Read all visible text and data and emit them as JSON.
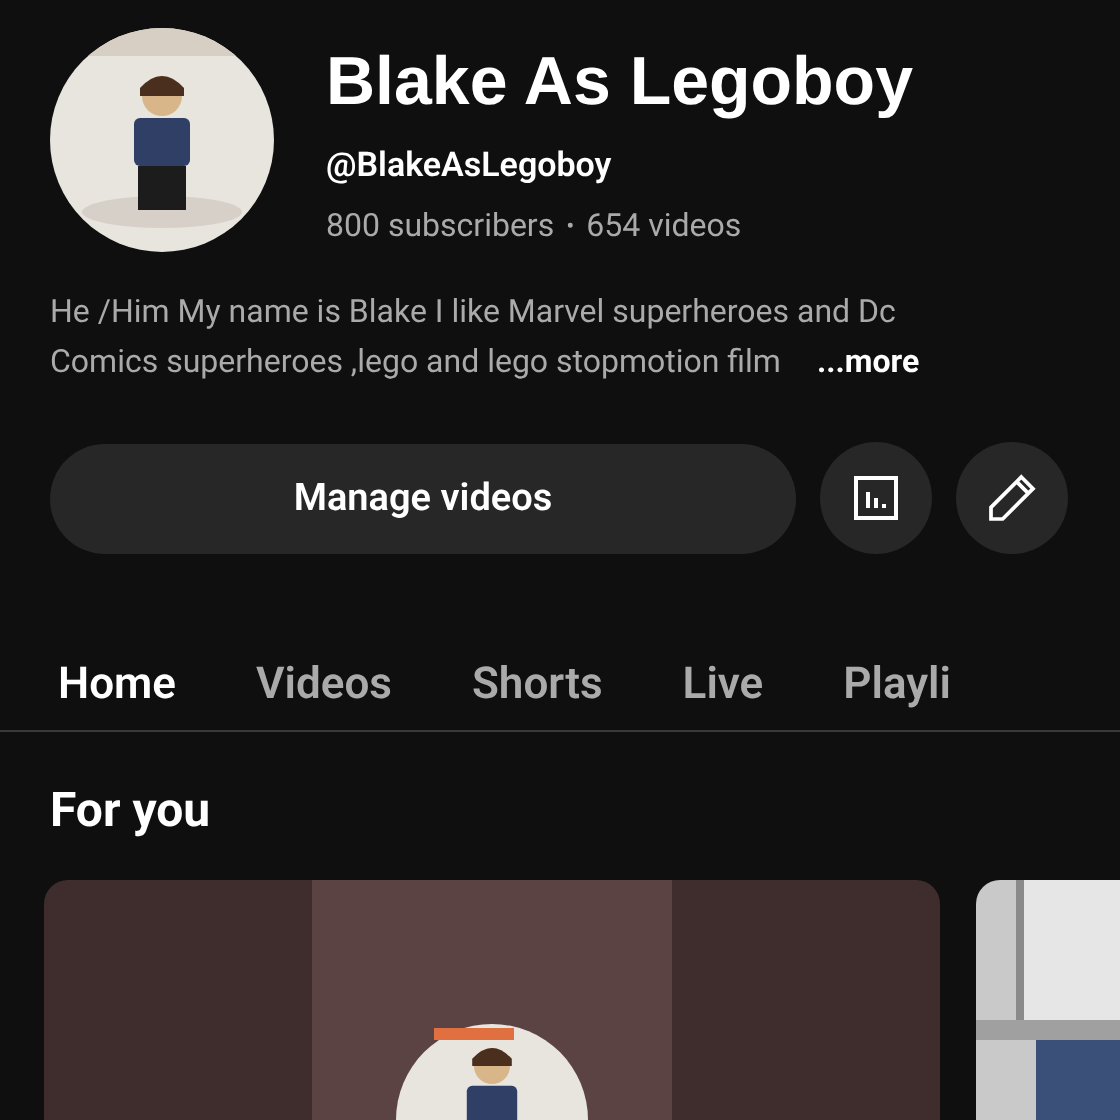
{
  "channel": {
    "name": "Blake As Legoboy",
    "handle": "@BlakeAsLegoboy",
    "subscribers": "800 subscribers",
    "separator": "•",
    "videos": "654 videos",
    "description": [
      "He /Him My name is Blake I like Marvel superheroes and Dc",
      "Comics superheroes ,lego and lego stopmotion film"
    ],
    "more": "...more"
  },
  "actions": {
    "manage": "Manage videos"
  },
  "tabs": [
    {
      "label": "Home",
      "selected": true
    },
    {
      "label": "Videos",
      "selected": false
    },
    {
      "label": "Shorts",
      "selected": false
    },
    {
      "label": "Live",
      "selected": false
    },
    {
      "label": "Playli",
      "selected": false
    }
  ],
  "section": {
    "title": "For you"
  }
}
